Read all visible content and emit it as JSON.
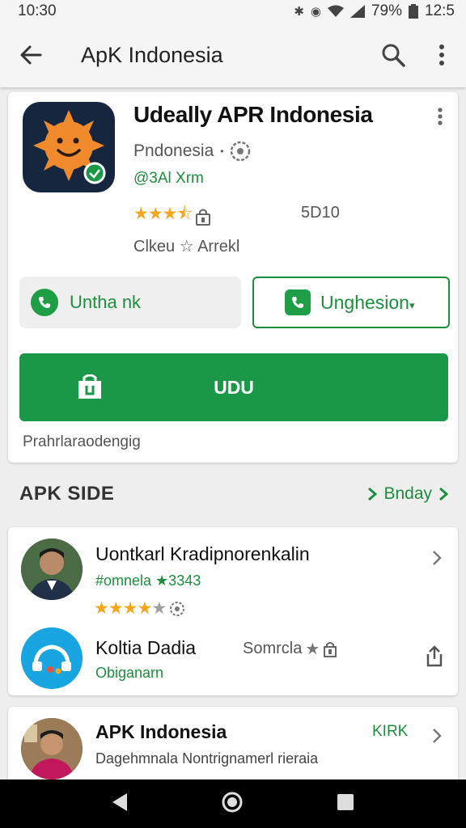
{
  "status_bar": {
    "time": "10:30",
    "battery_percent": "79%",
    "right_clock": "12:5"
  },
  "app_bar": {
    "title": "ApK Indonesia"
  },
  "app": {
    "name": "Udeally APR Indonesia",
    "developer": "Pndonesia",
    "tag": "@3Al Xrm",
    "rating_stars": 3.5,
    "downloads": "5D10",
    "age_rating": "Clkeu ☆ Arrekl",
    "icon_bg": "#16263f",
    "icon_sun": "#f08a2c"
  },
  "buttons": {
    "share_label": "Untha nk",
    "install2_label": "Unghesion",
    "primary_label": "UDU",
    "caption": "Prahrlaraodengig"
  },
  "section": {
    "title": "APK SIDE",
    "link_label": "Bnday"
  },
  "list": [
    {
      "title": "Uontkarl Kradipnorenkalin",
      "subtitle": "#omnela ★3343",
      "rating_stars": 4
    },
    {
      "title": "Koltia Dadia",
      "subtitle": "Obiganarn",
      "meta": "Somrcla"
    },
    {
      "title": "APK Indonesia",
      "subtitle": "Dagehmnala Nontrignamerl rieraia",
      "badge": "KIRK"
    }
  ],
  "colors": {
    "accent_green": "#1a9847",
    "star_orange": "#f4a61d"
  }
}
